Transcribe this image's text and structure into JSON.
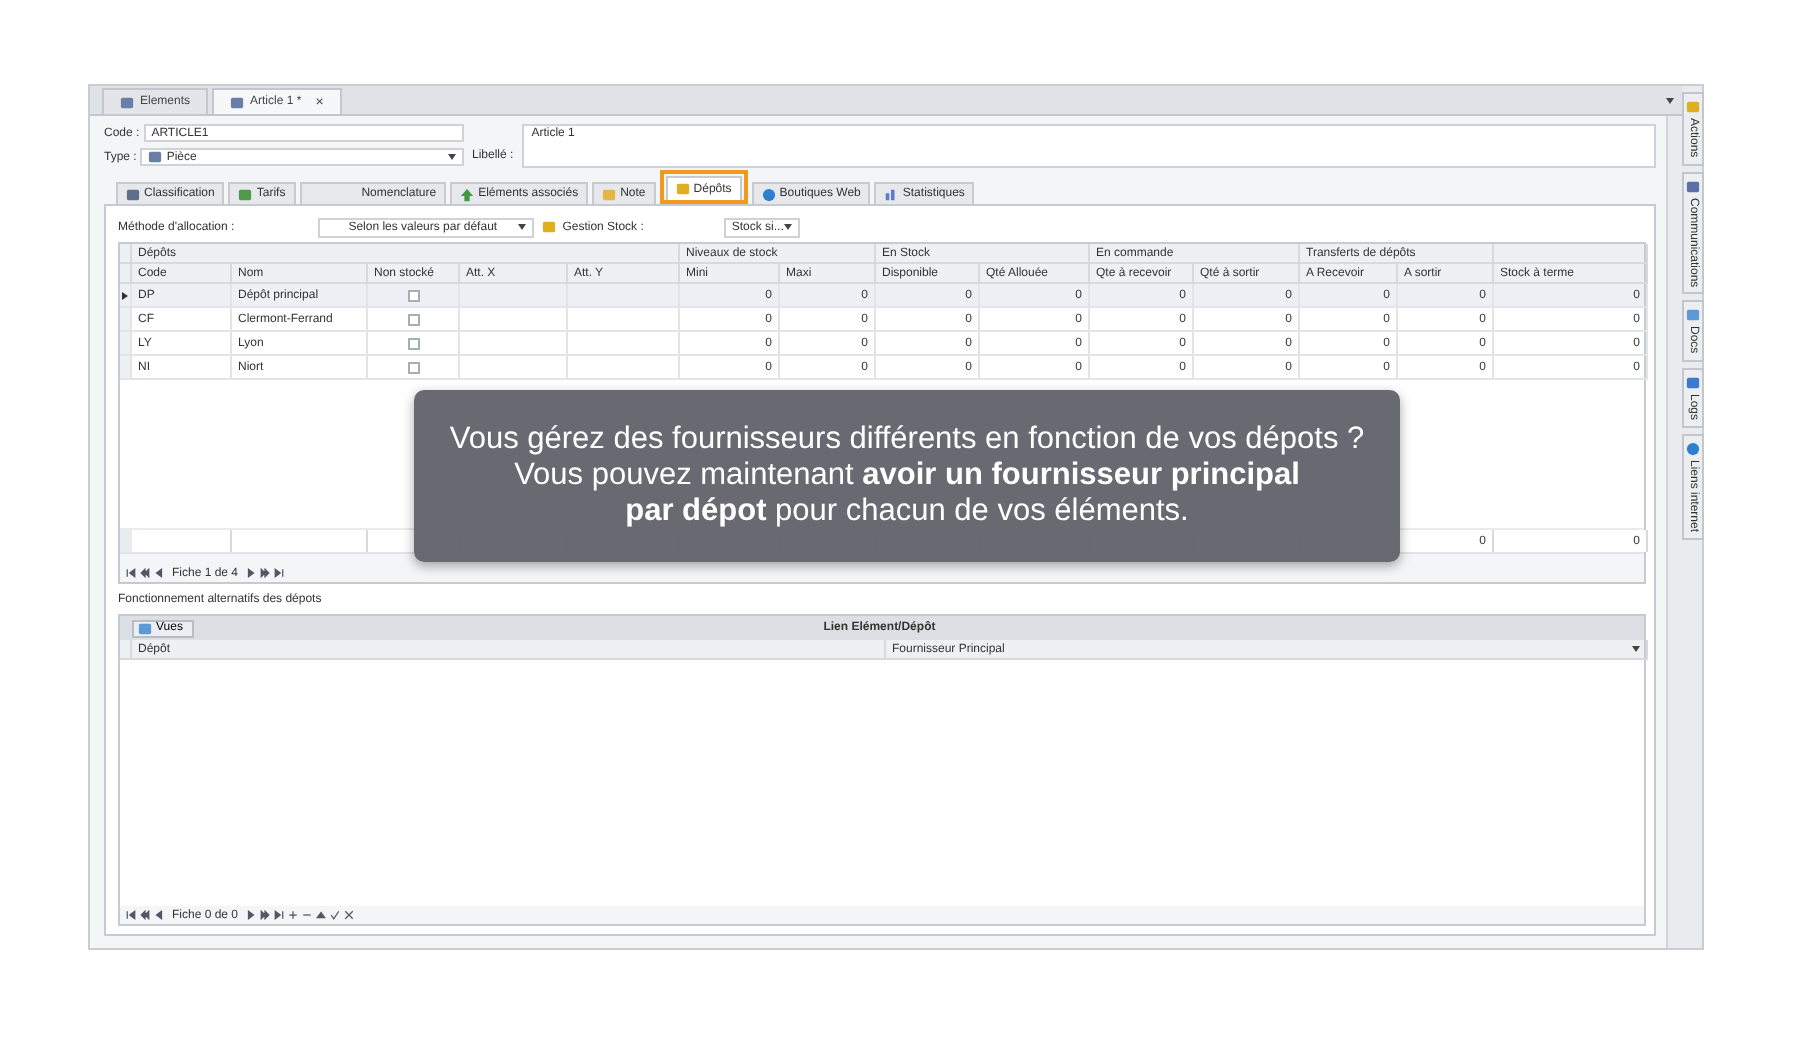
{
  "doc_tabs": [
    {
      "label": "Elements",
      "selected": false
    },
    {
      "label": "Article 1 *",
      "selected": true,
      "close": "×"
    }
  ],
  "header": {
    "code_label": "Code :",
    "code": "ARTICLE1",
    "type_label": "Type :",
    "type": "Pièce",
    "libelle_label": "Libellé :",
    "libelle": "Article 1"
  },
  "tabs": [
    {
      "label": "Classification",
      "selected": false
    },
    {
      "label": "Tarifs",
      "selected": false
    },
    {
      "label": "Nomenclature",
      "selected": false
    },
    {
      "label": "Eléments associés",
      "selected": false
    },
    {
      "label": "Note",
      "selected": false
    },
    {
      "label": "Dépôts",
      "selected": true,
      "highlighted": true
    },
    {
      "label": "Boutiques Web",
      "selected": false
    },
    {
      "label": "Statistiques",
      "selected": false
    }
  ],
  "allocation": {
    "label": "Méthode d'allocation :",
    "value": "Selon les valeurs par défaut",
    "stock_label": "Gestion Stock :",
    "stock_value": "Stock si..."
  },
  "grid": {
    "groups": [
      {
        "label": "Dépôts",
        "columns": [
          "Code",
          "Nom",
          "Non stocké",
          "Att. X",
          "Att. Y"
        ]
      },
      {
        "label": "Niveaux de stock",
        "columns": [
          "Mini",
          "Maxi"
        ]
      },
      {
        "label": "En Stock",
        "columns": [
          "Disponible",
          "Qté Allouée"
        ]
      },
      {
        "label": "En commande",
        "columns": [
          "Qte à recevoir",
          "Qté à sortir"
        ]
      },
      {
        "label": "Transferts de dépôts",
        "columns": [
          "A Recevoir",
          "A sortir"
        ]
      },
      {
        "columns": [
          "Stock à terme"
        ]
      }
    ],
    "rows": [
      {
        "selected": true,
        "code": "DP",
        "name": "Dépôt principal",
        "non_stocke": false,
        "values": [
          "0",
          "0",
          "0",
          "0",
          "0",
          "0",
          "0",
          "0",
          "0"
        ]
      },
      {
        "selected": false,
        "code": "CF",
        "name": "Clermont-Ferrand",
        "non_stocke": false,
        "values": [
          "0",
          "0",
          "0",
          "0",
          "0",
          "0",
          "0",
          "0",
          "0"
        ]
      },
      {
        "selected": false,
        "code": "LY",
        "name": "Lyon",
        "non_stocke": false,
        "values": [
          "0",
          "0",
          "0",
          "0",
          "0",
          "0",
          "0",
          "0",
          "0"
        ]
      },
      {
        "selected": false,
        "code": "NI",
        "name": "Niort",
        "non_stocke": false,
        "values": [
          "0",
          "0",
          "0",
          "0",
          "0",
          "0",
          "0",
          "0",
          "0"
        ]
      }
    ],
    "visible_totals": [
      "0",
      "0"
    ],
    "pager": "Fiche 1 de 4"
  },
  "alt_label": "Fonctionnement alternatifs des dépots",
  "alt_grid": {
    "views_button": "Vues",
    "title": "Lien Elément/Dépôt",
    "columns": [
      "Dépôt",
      "Fournisseur Principal"
    ],
    "pager": "Fiche 0 de 0"
  },
  "side_tabs": [
    "Actions",
    "Communications",
    "Docs",
    "Logs",
    "Liens internet"
  ],
  "overlay": {
    "lines": [
      "Vous gérez des fournisseurs différents en fonction de vos dépots ?",
      "Vous pouvez maintenant **avoir un fournisseur principal**",
      "**par dépot** pour chacun de vos éléments."
    ]
  }
}
